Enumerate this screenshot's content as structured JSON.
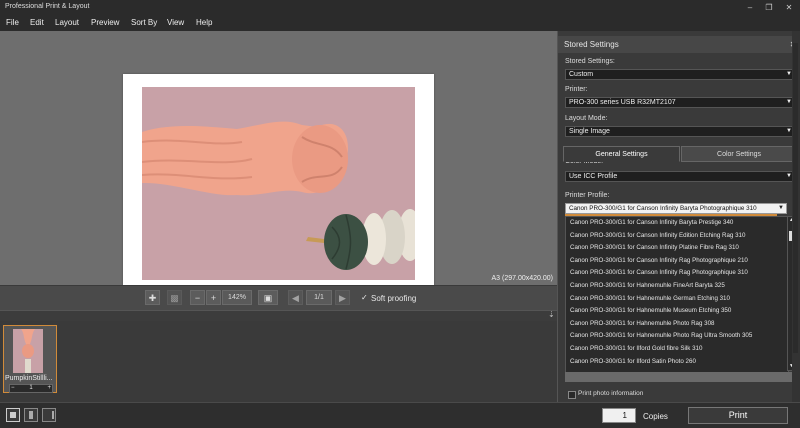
{
  "window": {
    "title": "Professional Print & Layout"
  },
  "menu": [
    "File",
    "Edit",
    "Layout",
    "Preview",
    "Sort By",
    "View",
    "Help"
  ],
  "canvas": {
    "paper_size": "A3 (297.00x420.00)"
  },
  "toolbar": {
    "zoom": "142%",
    "page": "1/1",
    "soft_proofing": "Soft proofing"
  },
  "thumbnail": {
    "name": "PumpkinStillli...",
    "copies": "1"
  },
  "bottom": {
    "copies_value": "1",
    "copies_label": "Copies",
    "print_label": "Print"
  },
  "panel": {
    "header": "Stored Settings",
    "stored_settings_label": "Stored Settings:",
    "stored_settings_value": "Custom",
    "printer_label": "Printer:",
    "printer_value": "PRO-300 series USB R32MT2107",
    "layout_mode_label": "Layout Mode:",
    "layout_mode_value": "Single Image",
    "tabs": [
      "General Settings",
      "Color Settings"
    ],
    "color_mode_label": "Color Mode:",
    "color_mode_value": "Use ICC Profile",
    "printer_profile_label": "Printer Profile:",
    "printer_profile_value": "Canon PRO-300/G1 for Canson Infinity Baryta Photographique 310",
    "profile_options": [
      "Canon PRO-300/G1 for Canson Infinity Baryta Prestige 340",
      "Canon PRO-300/G1 for Canson Infinity Edition Etching Rag 310",
      "Canon PRO-300/G1 for Canson Infinity Platine Fibre Rag 310",
      "Canon PRO-300/G1 for Canson Infinity Rag Photographique 210",
      "Canon PRO-300/G1 for Canson Infinity Rag Photographique 310",
      "Canon PRO-300/G1 for Hahnemuhle FineArt Baryta 325",
      "Canon PRO-300/G1 for Hahnemuhle German Etching 310",
      "Canon PRO-300/G1 for Hahnemuhle Museum Etching 350",
      "Canon PRO-300/G1 for Hahnemuhle Photo Rag 308",
      "Canon PRO-300/G1 for Hahnemuhle Photo Rag Ultra Smooth 305",
      "Canon PRO-300/G1 for Ilford Gold fibre Silk 310",
      "Canon PRO-300/G1 for Ilford Satin Photo 260"
    ],
    "print_photo_info": "Print photo information"
  },
  "colors": {
    "accent": "#d18b3a",
    "background": "#3a3a3a",
    "canvas": "#6e6e6e",
    "photo_bg": "#c8a1a7"
  }
}
